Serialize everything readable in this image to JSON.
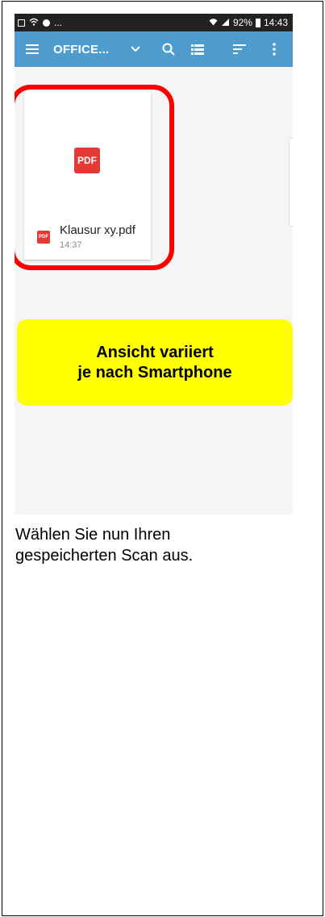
{
  "status_bar": {
    "left_icons": [
      "image-icon",
      "wifi-call-icon",
      "notification-dot-icon"
    ],
    "left_more": "...",
    "signal_text": "92%",
    "time": "14:43"
  },
  "toolbar": {
    "title": "OFFICE...",
    "icons": [
      "menu-icon",
      "chevron-down-icon",
      "search-icon",
      "list-view-icon",
      "sort-icon",
      "more-vert-icon"
    ]
  },
  "file": {
    "big_icon_label": "PDF",
    "small_icon_label": "PDF",
    "name": "Klausur xy.pdf",
    "time": "14:37"
  },
  "note": {
    "line1": "Ansicht variiert",
    "line2": "je nach Smartphone"
  },
  "caption": {
    "line1": "Wählen Sie nun Ihren",
    "line2": "gespeicherten Scan aus."
  },
  "colors": {
    "toolbar": "#4e9ccd",
    "status_bar": "#222222",
    "highlight": "#ff0000",
    "note_background": "#ffff00",
    "pdf_icon": "#e53935"
  }
}
